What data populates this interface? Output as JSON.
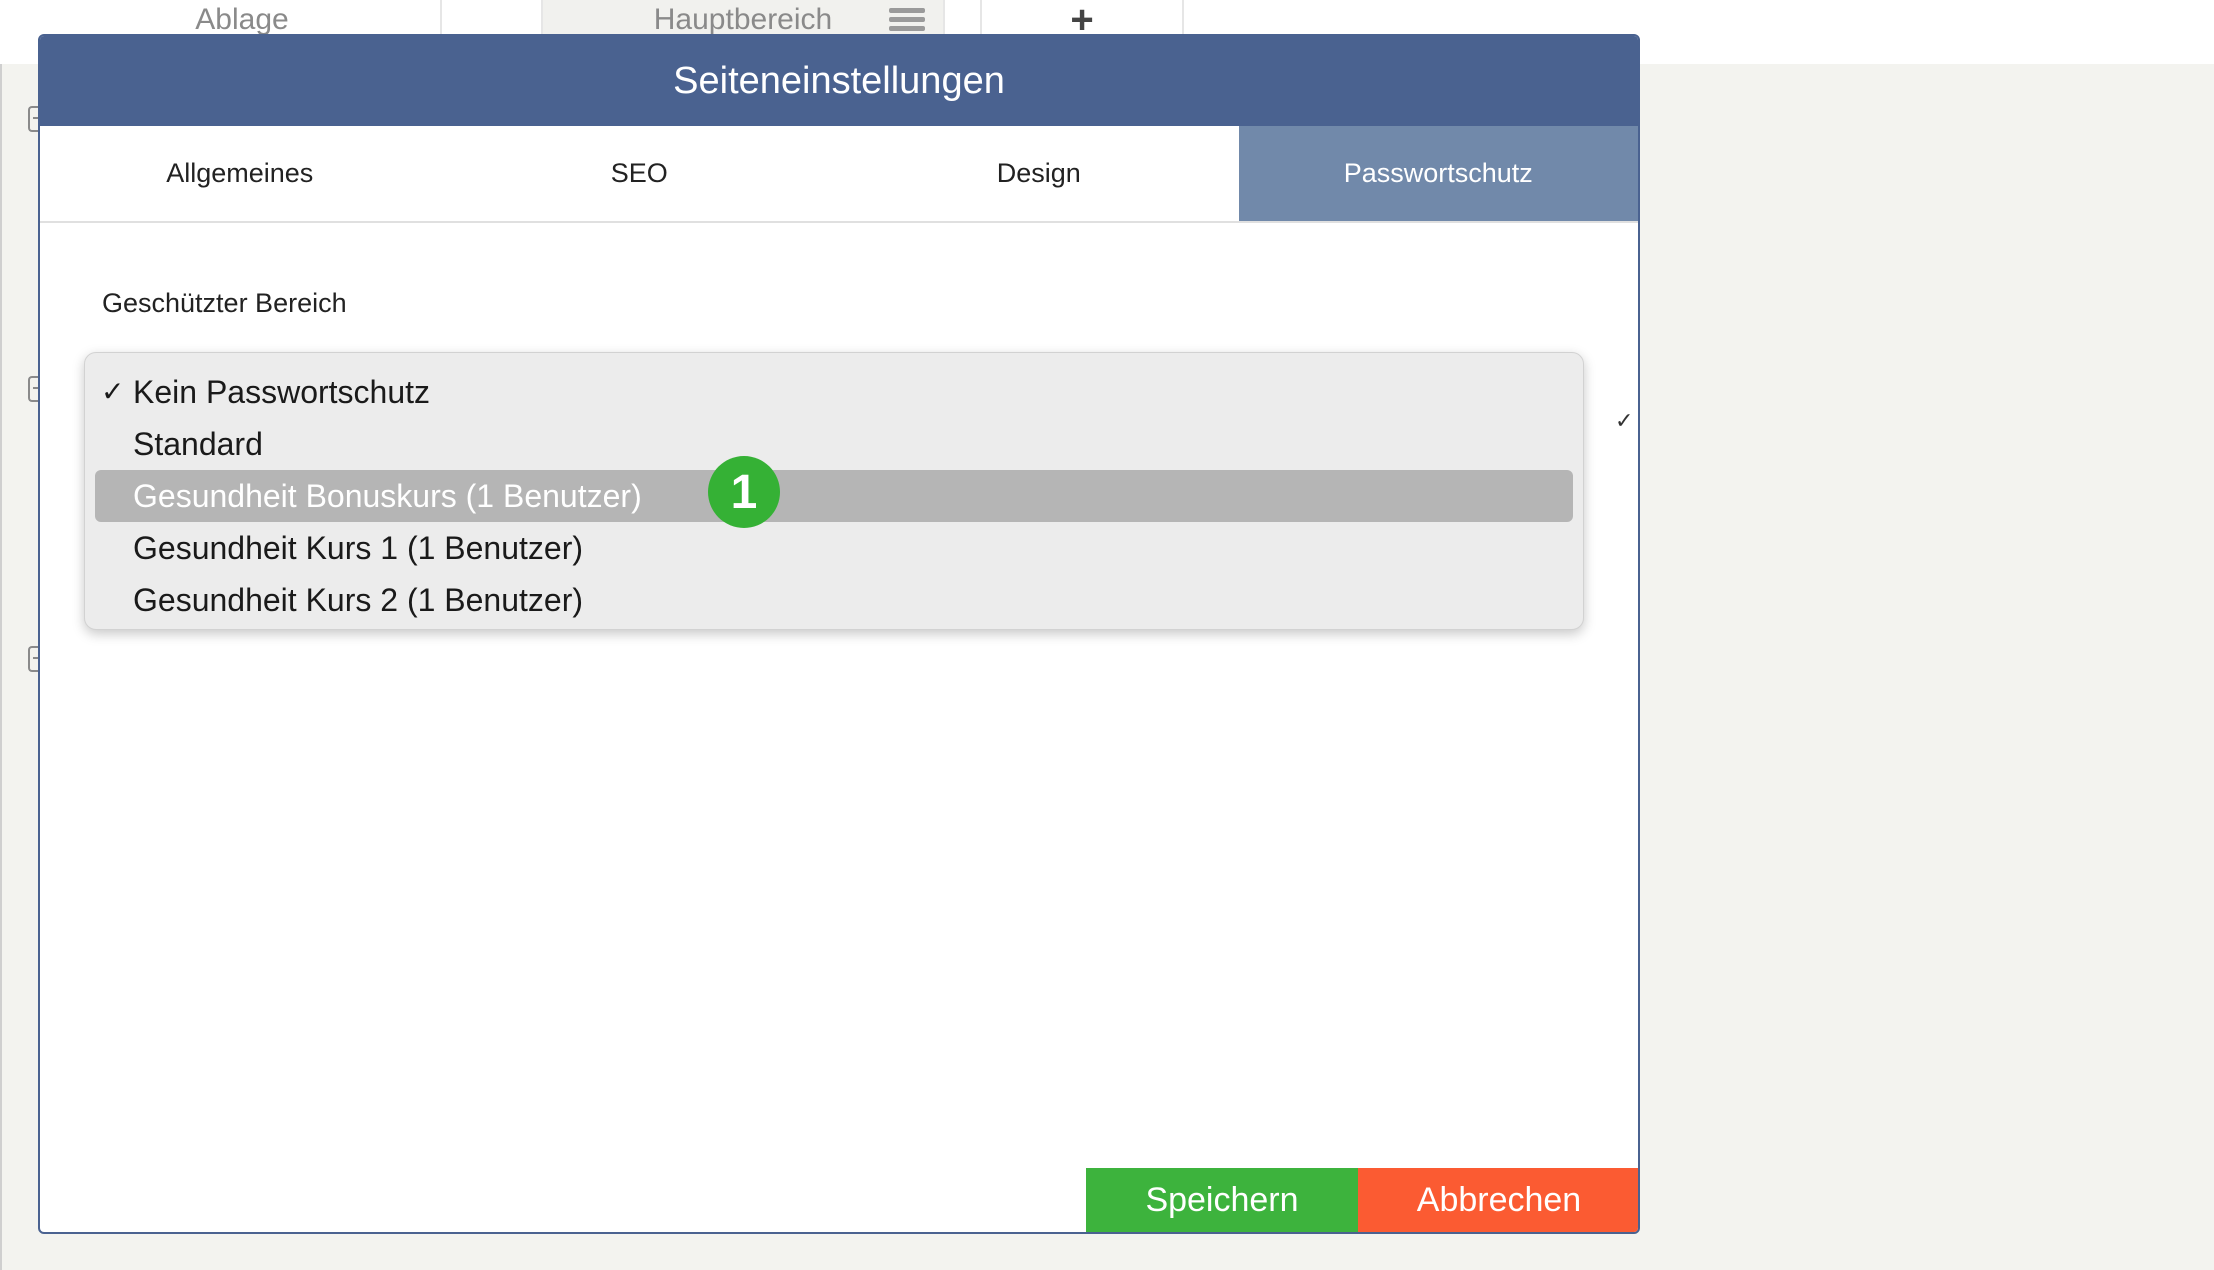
{
  "background": {
    "tabs": [
      "Ablage",
      "Hauptbereich",
      "+"
    ]
  },
  "modal": {
    "title": "Seiteneinstellungen",
    "tabs": [
      {
        "label": "Allgemeines",
        "active": false
      },
      {
        "label": "SEO",
        "active": false
      },
      {
        "label": "Design",
        "active": false
      },
      {
        "label": "Passwortschutz",
        "active": true
      }
    ],
    "field_label": "Geschützter Bereich",
    "dropdown": {
      "checkmark": "✓",
      "options": [
        {
          "label": "Kein Passwortschutz",
          "selected": true
        },
        {
          "label": "Standard",
          "selected": false
        },
        {
          "label": "Gesundheit Bonuskurs (1 Benutzer)",
          "highlighted": true
        },
        {
          "label": "Gesundheit Kurs 1 (1 Benutzer)",
          "selected": false
        },
        {
          "label": "Gesundheit Kurs 2 (1 Benutzer)",
          "selected": false
        }
      ]
    },
    "step_badge": "1",
    "buttons": {
      "save": "Speichern",
      "cancel": "Abbrechen"
    }
  },
  "colors": {
    "header": "#4a6290",
    "active_tab": "#7189aa",
    "save": "#3db33d",
    "cancel": "#fb5b32",
    "badge": "#35b135"
  }
}
